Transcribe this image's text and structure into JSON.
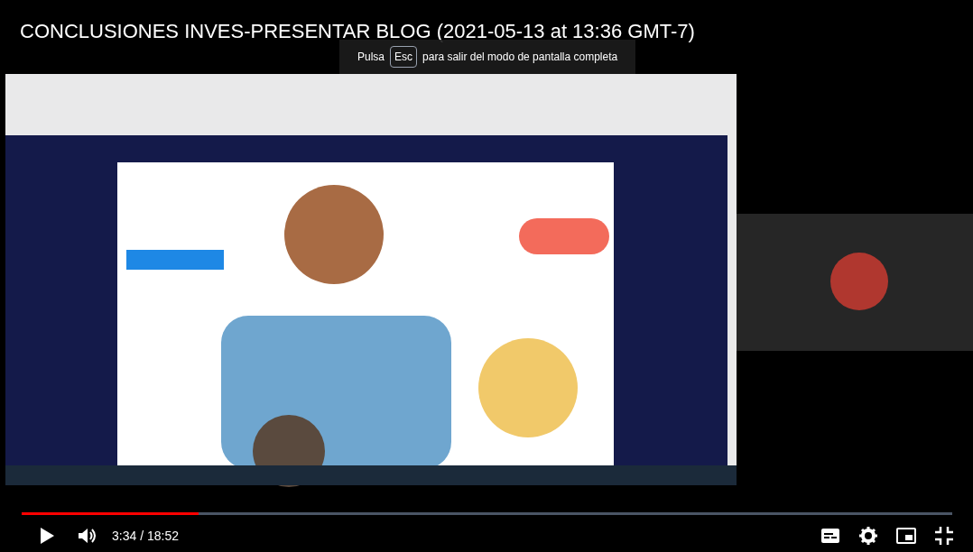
{
  "video": {
    "title": "CONCLUSIONES INVES-PRESENTAR BLOG (2021-05-13 at 13:36 GMT-7)"
  },
  "fullscreen_hint": {
    "before": "Pulsa",
    "key": "Esc",
    "after": "para salir del modo de pantalla completa"
  },
  "controls": {
    "progress": {
      "level": 0.19
    },
    "muted": false,
    "time": "3:34 / 18:52"
  }
}
